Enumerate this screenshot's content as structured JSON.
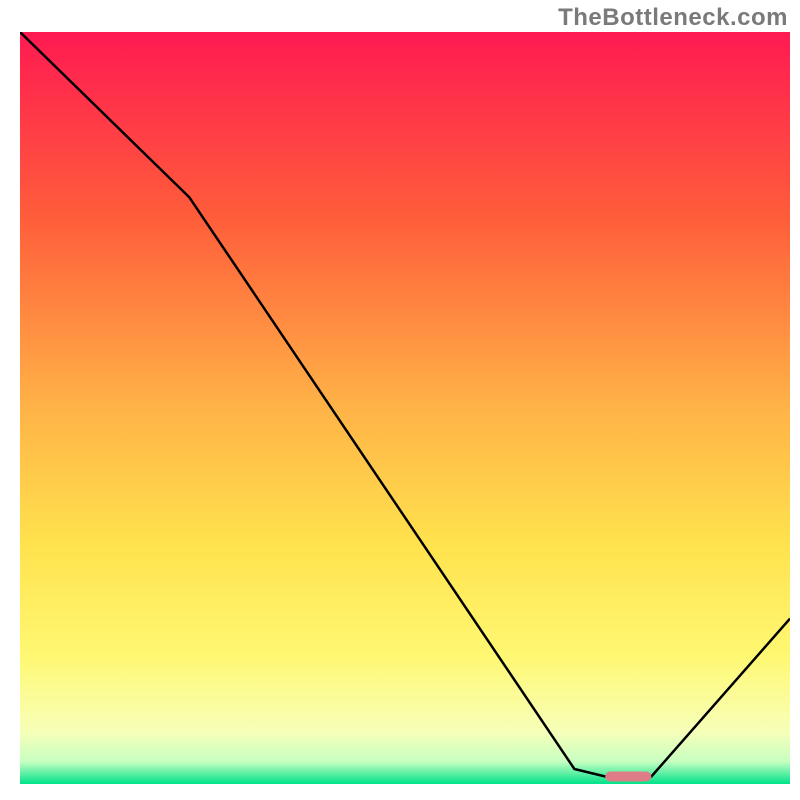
{
  "watermark": "TheBottleneck.com",
  "chart_data": {
    "type": "line",
    "title": "",
    "xlabel": "",
    "ylabel": "",
    "xlim": [
      0,
      100
    ],
    "ylim": [
      0,
      100
    ],
    "gradient_stops": [
      {
        "offset": 0.0,
        "color": "#ff1a52"
      },
      {
        "offset": 0.25,
        "color": "#ff5e3a"
      },
      {
        "offset": 0.5,
        "color": "#ffb347"
      },
      {
        "offset": 0.68,
        "color": "#ffe24d"
      },
      {
        "offset": 0.83,
        "color": "#fff873"
      },
      {
        "offset": 0.93,
        "color": "#f7ffb8"
      },
      {
        "offset": 0.97,
        "color": "#c8ffc1"
      },
      {
        "offset": 1.0,
        "color": "#00e28a"
      }
    ],
    "series": [
      {
        "name": "bottleneck-curve",
        "x": [
          0,
          22,
          72,
          76,
          82,
          100
        ],
        "y": [
          100,
          78,
          2,
          1,
          1,
          22
        ]
      }
    ],
    "marker": {
      "name": "optimal-range",
      "x_start": 76,
      "x_end": 82,
      "y": 1,
      "color": "#de7d87"
    }
  }
}
